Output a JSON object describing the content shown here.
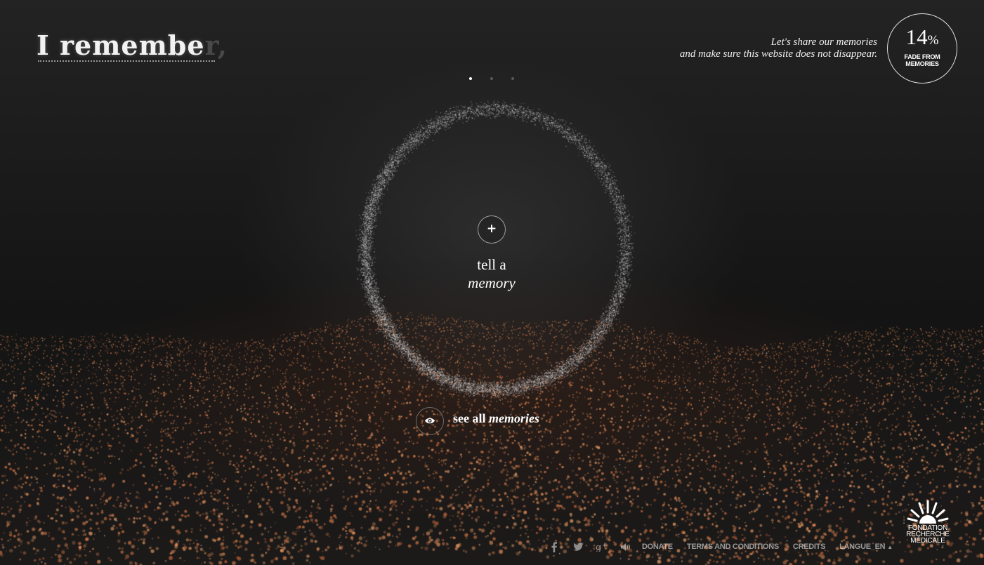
{
  "colors": {
    "background": "#1b1b1b",
    "particle_ring": "#d8d8d8",
    "particle_ground": "#e07a4a",
    "text": "#ffffff"
  },
  "logo": {
    "text_visible": "I remembe",
    "text_faded": "r,"
  },
  "tagline": {
    "line1": "Let's share our memories",
    "line2": "and make sure this website does not disappear."
  },
  "fade_counter": {
    "value": "14",
    "unit": "%",
    "label_line1": "FADE FROM",
    "label_line2": "MEMORIES"
  },
  "pager": {
    "count": 3,
    "active_index": 0
  },
  "tell_memory": {
    "button_icon": "plus-icon",
    "plus_symbol": "+",
    "line1": "tell a",
    "line2": "memory"
  },
  "see_all": {
    "icon": "eye-icon",
    "text_plain": "see all",
    "text_italic": "memories"
  },
  "footer": {
    "social_icons": [
      "facebook-icon",
      "twitter-icon",
      "google-plus-icon",
      "sound-icon"
    ],
    "donate": "DONATE",
    "terms": "TERMS AND CONDITIONS",
    "credits": "CREDITS",
    "language": "LANGUE_EN",
    "language_caret": "▲"
  },
  "foundation": {
    "icon": "sun-icon",
    "line1": "FONDATION",
    "line2": "RECHERCHE",
    "line3": "MÉDICALE"
  }
}
